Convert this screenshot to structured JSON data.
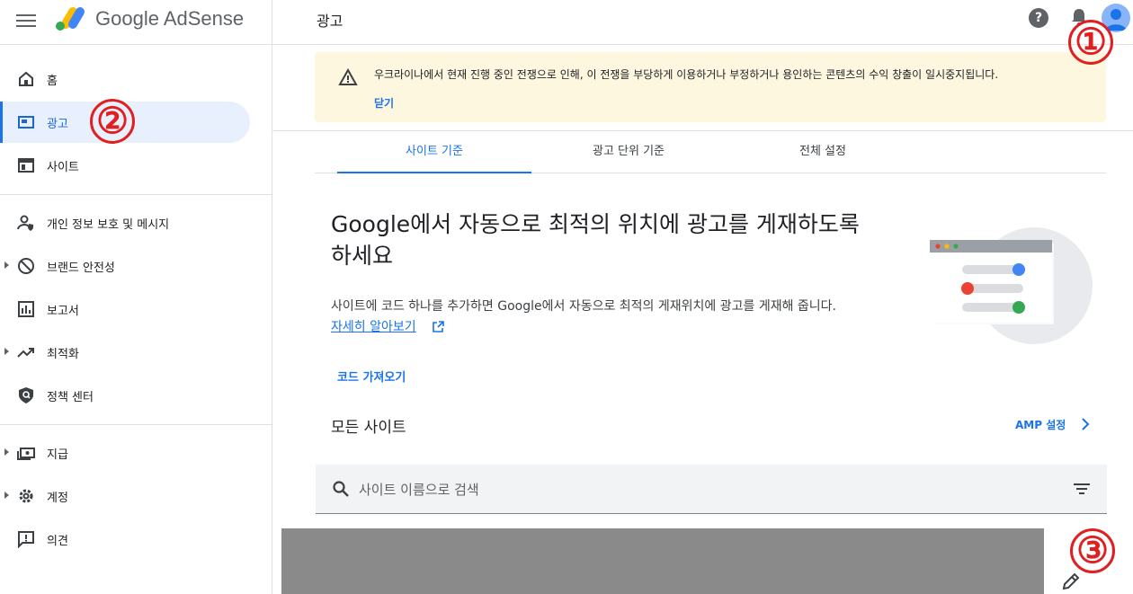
{
  "header": {
    "brand": "Google AdSense",
    "page_title": "광고",
    "help_glyph": "?"
  },
  "annotations": [
    "①",
    "②",
    "③"
  ],
  "sidebar": {
    "items": [
      {
        "label": "홈",
        "icon": "home-icon"
      },
      {
        "label": "광고",
        "icon": "ads-icon",
        "active": true
      },
      {
        "label": "사이트",
        "icon": "sites-icon"
      },
      {
        "label": "개인 정보 보호 및 메시지",
        "icon": "privacy-icon"
      },
      {
        "label": "브랜드 안전성",
        "icon": "block-icon",
        "expandable": true
      },
      {
        "label": "보고서",
        "icon": "bar-chart-icon"
      },
      {
        "label": "최적화",
        "icon": "trending-icon",
        "expandable": true
      },
      {
        "label": "정책 센터",
        "icon": "shield-icon"
      },
      {
        "label": "지급",
        "icon": "payments-icon",
        "expandable": true
      },
      {
        "label": "계정",
        "icon": "gear-icon",
        "expandable": true
      },
      {
        "label": "의견",
        "icon": "feedback-icon"
      }
    ]
  },
  "banner": {
    "message": "우크라이나에서 현재 진행 중인 전쟁으로 인해, 이 전쟁을 부당하게 이용하거나 부정하거나 용인하는 콘텐츠의 수익 창출이 일시중지됩니다.",
    "dismiss": "닫기"
  },
  "tabs": [
    "사이트 기준",
    "광고 단위 기준",
    "전체 설정"
  ],
  "main": {
    "headline_line1": "Google에서 자동으로 최적의 위치에 광고를 게재하도록",
    "headline_line2": "하세요",
    "description": "사이트에 코드 하나를 추가하면 Google에서 자동으로 최적의 게재위치에 광고를 게재해 줍니다.",
    "learn_more": "자세히 알아보기",
    "get_code": "코드 가져오기",
    "all_sites": "모든 사이트",
    "amp_settings": "AMP 설정"
  },
  "search": {
    "placeholder": "사이트 이름으로 검색"
  },
  "colors": {
    "accent": "#1a73e8",
    "annotation": "#e02020",
    "banner_bg": "#fef7e0",
    "active_nav_bg": "#e8f0fe"
  }
}
